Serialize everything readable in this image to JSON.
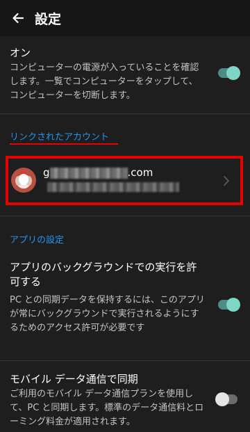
{
  "appbar": {
    "title": "設定"
  },
  "power": {
    "title": "オン",
    "description": "コンピューターの電源が入っていることを確認します。一覧でコンピューターをタップして、コンピューターを切断します。",
    "enabled": true
  },
  "linked_accounts": {
    "header": "リンクされたアカウント",
    "account": {
      "email_prefix": "g",
      "email_suffix": ".com"
    }
  },
  "app_settings": {
    "header": "アプリの設定",
    "background": {
      "title": "アプリのバックグラウンドでの実行を許可する",
      "description": "PC との同期データを保持するには、このアプリが常にバックグラウンドで実行されるようにするためのアクセス許可が必要です",
      "enabled": true
    },
    "mobile_data": {
      "title": "モバイル データ通信で同期",
      "description": "ご利用のモバイル データ通信プランを使用して、PC と同期します。標準のデータ通信料とローミング料金が適用されます。",
      "enabled": false
    }
  },
  "colors": {
    "accent": "#2196f3",
    "toggle_on": "#7dd6c6",
    "highlight": "#e60000"
  }
}
